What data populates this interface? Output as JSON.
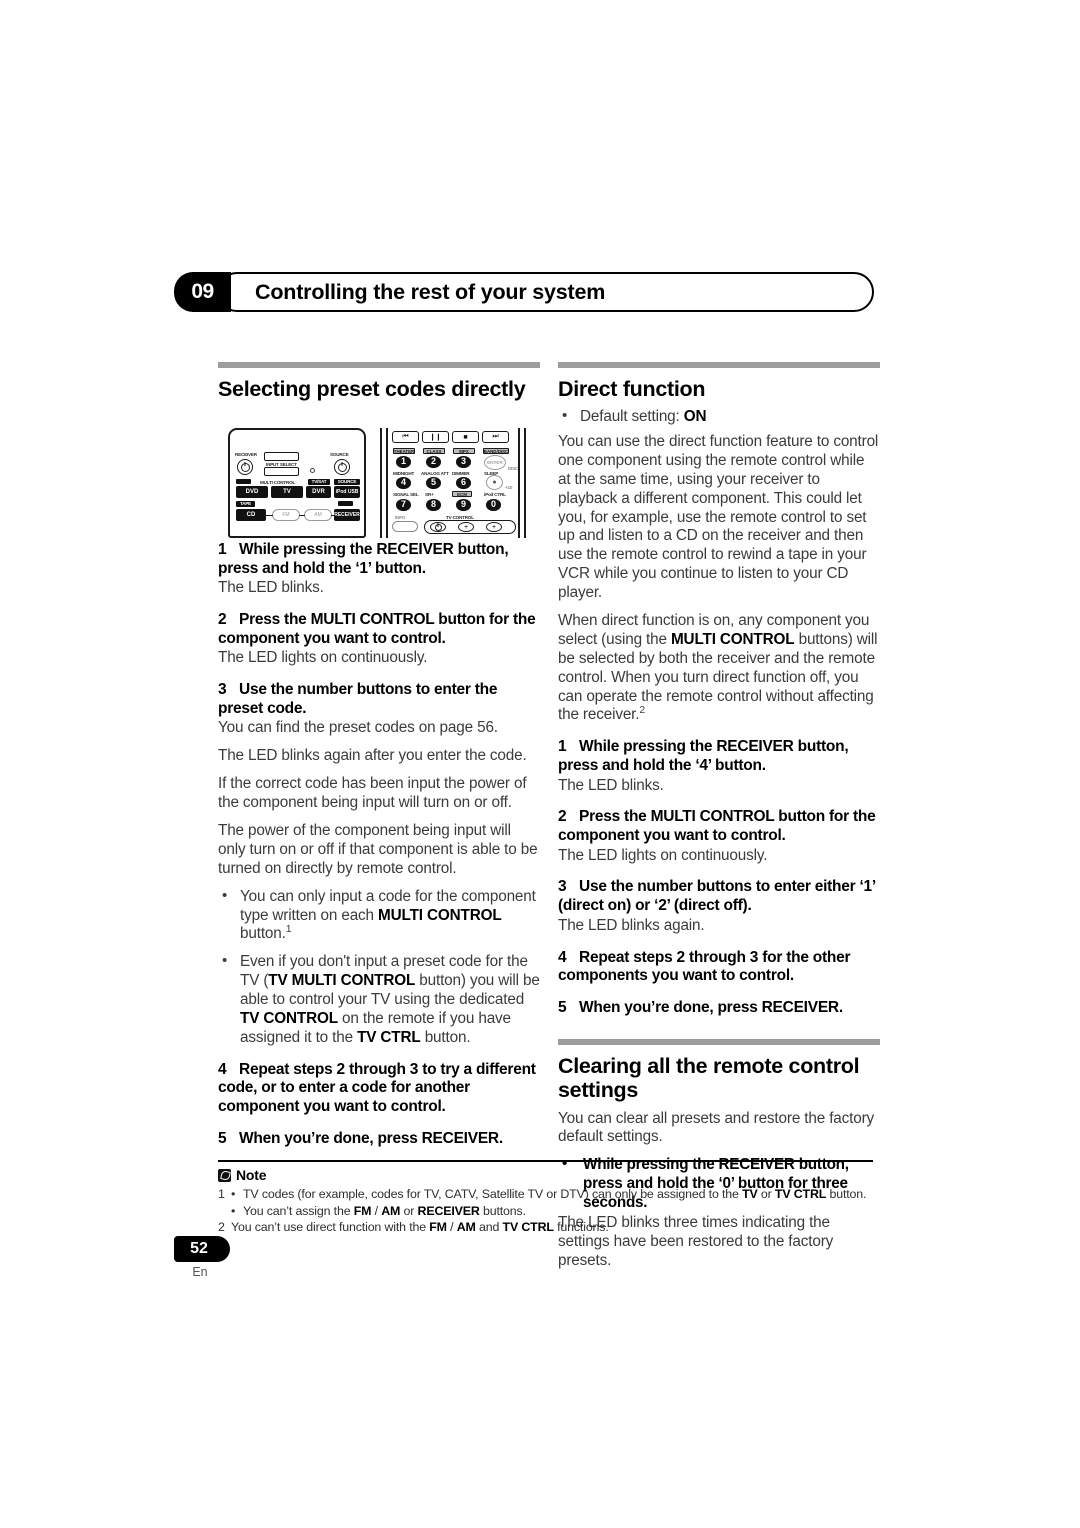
{
  "header": {
    "chapter_number": "09",
    "chapter_title": "Controlling the rest of your system"
  },
  "left_column": {
    "section_title": "Selecting preset codes directly",
    "steps": [
      {
        "num": "1",
        "title_a": "While pressing the RECEIVER button, press and hold the ‘1’ button.",
        "sub": "The LED blinks."
      },
      {
        "num": "2",
        "title_a": "Press the MULTI CONTROL button for the component you want to control.",
        "sub": "The LED lights on continuously."
      },
      {
        "num": "3",
        "title_a": "Use the number buttons to enter the preset code.",
        "sub": "You can find the preset codes on page 56."
      }
    ],
    "para_led_blinks_again": "The LED blinks again after you enter the code.",
    "para_correct_code": "If the correct code has been input the power of the component being input will turn on or off.",
    "para_power_component": "The power of the component being input will only turn on or off if that component is able to be turned on directly by remote control.",
    "bullet_1_pre": "You can only input a code for the component type written on each ",
    "bullet_1_bold": "MULTI CONTROL",
    "bullet_1_post": " button.",
    "bullet_1_sup": "1",
    "bullet_2_pre": "Even if you don't input a preset code for the TV (",
    "bullet_2_bold_1": "TV MULTI CONTROL",
    "bullet_2_mid_1": " button) you will be able to control your TV using the dedicated ",
    "bullet_2_bold_2": "TV CONTROL",
    "bullet_2_mid_2": " on the remote if you have assigned it to the ",
    "bullet_2_bold_3": "TV CTRL",
    "bullet_2_post": " button.",
    "step_4_num": "4",
    "step_4_text": "Repeat steps 2 through 3 to try a different code, or to enter a code for another component you want to control.",
    "step_5_num": "5",
    "step_5_text": "When you’re done, press RECEIVER."
  },
  "right_column": {
    "section_title": "Direct function",
    "default_setting_label": "Default setting: ",
    "default_setting_value": "ON",
    "para_1": "You can use the direct function feature to control one component using the remote control while at the same time, using your receiver to playback a different component. This could let you, for example, use the remote control to set up and listen to a CD on the receiver and then use the remote control to rewind a tape in your VCR while you continue to listen to your CD player.",
    "para_2_pre": "When direct function is on, any component you select (using the ",
    "para_2_bold": "MULTI CONTROL",
    "para_2_post": " buttons) will be selected by both the receiver and the remote control. When you turn direct function off, you can operate the remote control without affecting the receiver.",
    "para_2_sup": "2",
    "steps": [
      {
        "num": "1",
        "title_a": "While pressing the RECEIVER button, press and hold the ‘4’ button.",
        "sub": "The LED blinks."
      },
      {
        "num": "2",
        "title_a": "Press the MULTI CONTROL button for the component you want to control.",
        "sub": "The LED lights on continuously."
      },
      {
        "num": "3",
        "title_a": "Use the number buttons to enter either ‘1’ (direct on) or ‘2’ (direct off).",
        "sub": "The LED blinks again."
      },
      {
        "num": "4",
        "title_a": "Repeat steps 2 through 3 for the other components you want to control.",
        "sub": ""
      },
      {
        "num": "5",
        "title_a": "When you’re done, press RECEIVER.",
        "sub": ""
      }
    ],
    "clearing_title": "Clearing all the remote control settings",
    "clearing_para": "You can clear all presets and restore the factory default settings.",
    "clearing_bullet": "While pressing the RECEIVER button, press and hold the ‘0’ button for three seconds.",
    "clearing_sub": "The LED blinks three times indicating the settings have been restored to the factory presets."
  },
  "note": {
    "heading": "Note",
    "fn1_mark": "1",
    "fn1_a_pre": "TV codes (for example, codes for TV, CATV, Satellite TV or DTV) can only be assigned to the ",
    "fn1_a_bold1": "TV",
    "fn1_a_mid": " or ",
    "fn1_a_bold2": "TV CTRL",
    "fn1_a_post": " button.",
    "fn1_b_pre": "You can’t assign the ",
    "fn1_b_bold1": "FM",
    "fn1_b_mid1": " / ",
    "fn1_b_bold2": "AM",
    "fn1_b_mid2": " or ",
    "fn1_b_bold3": "RECEIVER",
    "fn1_b_post": " buttons.",
    "fn2_mark": "2",
    "fn2_pre": "You can’t use direct function with the ",
    "fn2_bold1": "FM",
    "fn2_mid1": " / ",
    "fn2_bold2": "AM",
    "fn2_mid2": " and ",
    "fn2_bold3": "TV CTRL",
    "fn2_post": " functions."
  },
  "footer": {
    "page_number": "52",
    "language": "En"
  },
  "remote": {
    "left_panel": {
      "receiver_label": "RECEIVER",
      "source_label": "SOURCE",
      "input_select_label": "INPUT SELECT",
      "multi_control_label": "MULTI CONTROL",
      "keys": [
        "DVD",
        "TV",
        "DVR",
        "iPod USB",
        "CD",
        "FM",
        "AM",
        "RECEIVER"
      ],
      "tags": [
        "TV/SAT",
        "SOURCE",
        "TAPE"
      ]
    },
    "right_panel": {
      "transport": [
        "prev",
        "pause",
        "stop",
        "next"
      ],
      "tags_row1": [
        "THEATER",
        "CLASS",
        "MPX",
        "BAND/DISC"
      ],
      "numbers_row1": [
        "1",
        "2",
        "3"
      ],
      "enter_label": "ENTER",
      "disc_label": "DISC",
      "tags_row2": [
        "MIDNIGHT",
        "ANALOG ATT",
        "DIMMER",
        "SLEEP"
      ],
      "numbers_row2": [
        "4",
        "5",
        "6"
      ],
      "plus10_label": "+10",
      "tags_row3": [
        "SIGNAL SEL",
        "SR+",
        "ECM",
        "iPod CTRL"
      ],
      "numbers_row3": [
        "7",
        "8",
        "9",
        "0"
      ],
      "info_label": "INFO",
      "tv_control_label": "TV CONTROL"
    }
  }
}
